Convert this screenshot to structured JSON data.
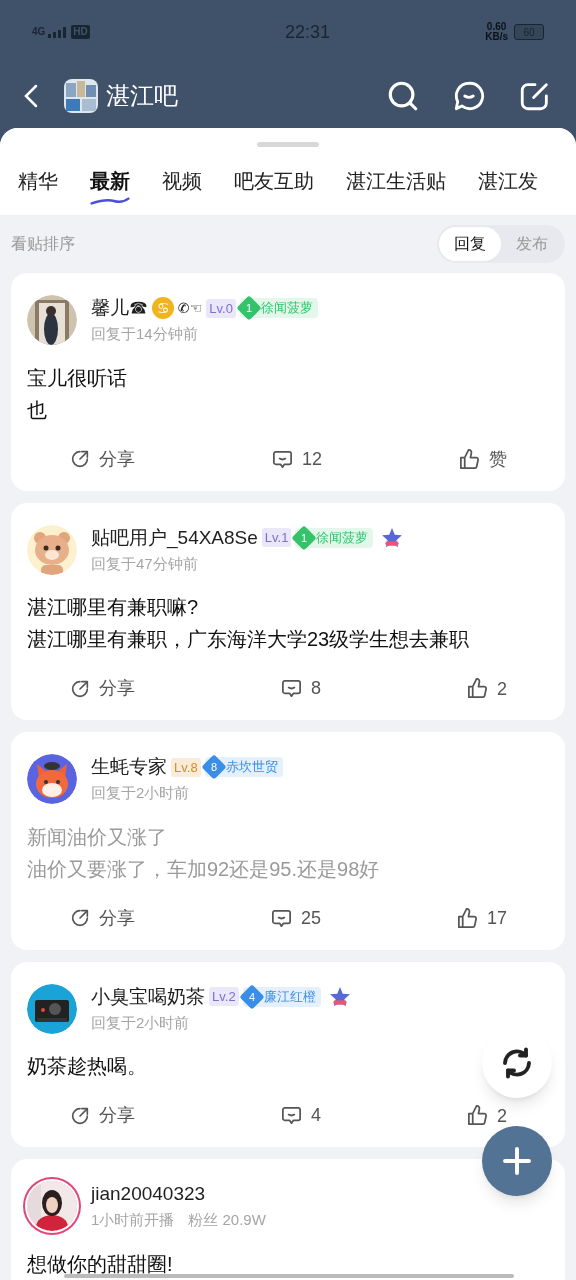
{
  "status_bar": {
    "network": "4G",
    "hd": "HD",
    "time": "22:31",
    "speed": "0.60",
    "speed_unit": "KB/s",
    "battery": "60"
  },
  "header": {
    "title": "湛江吧"
  },
  "tabs": [
    {
      "label": "精华",
      "selected": false
    },
    {
      "label": "最新",
      "selected": true
    },
    {
      "label": "视频",
      "selected": false
    },
    {
      "label": "吧友互助",
      "selected": false
    },
    {
      "label": "湛江生活贴",
      "selected": false
    },
    {
      "label": "湛江发",
      "selected": false
    }
  ],
  "sort": {
    "label": "看贴排序",
    "options": [
      {
        "label": "回复",
        "selected": true
      },
      {
        "label": "发布",
        "selected": false
      }
    ]
  },
  "posts": [
    {
      "kind": "reply",
      "name": "馨儿☎",
      "emoji": "♋",
      "symbols": "✆☜",
      "level": {
        "label": "Lv.0",
        "color": "#7c6fd6"
      },
      "fan": {
        "number": "1",
        "name": "徐闻菠萝",
        "color": "#34c26b"
      },
      "medal": false,
      "meta": "回复于14分钟前",
      "title": "宝儿很听话",
      "body": "也",
      "read": false,
      "share": "分享",
      "comments": "12",
      "likes": "赞"
    },
    {
      "kind": "reply",
      "name": "贴吧用户_54XA8Se",
      "level": {
        "label": "Lv.1",
        "color": "#7c6fd6"
      },
      "fan": {
        "number": "1",
        "name": "徐闻菠萝",
        "color": "#34c26b"
      },
      "medal": true,
      "meta": "回复于47分钟前",
      "title": "湛江哪里有兼职嘛?",
      "body": "湛江哪里有兼职，广东海洋大学23级学生想去兼职",
      "read": false,
      "share": "分享",
      "comments": "8",
      "likes": "2"
    },
    {
      "kind": "reply",
      "name": "生蚝专家",
      "level": {
        "label": "Lv.8",
        "color": "#e08a1e"
      },
      "fan": {
        "number": "8",
        "name": "赤坎世贸",
        "color": "#3a8ee6"
      },
      "medal": false,
      "meta": "回复于2小时前",
      "title": "新闻油价又涨了",
      "body": "油价又要涨了，车加92还是95.还是98好",
      "read": true,
      "share": "分享",
      "comments": "25",
      "likes": "17"
    },
    {
      "kind": "reply",
      "name": "小臭宝喝奶茶",
      "level": {
        "label": "Lv.2",
        "color": "#7c6fd6"
      },
      "fan": {
        "number": "4",
        "name": "廉江红橙",
        "color": "#3a8ee6"
      },
      "medal": true,
      "meta": "回复于2小时前",
      "title": "奶茶趁热喝。",
      "read": false,
      "share": "分享",
      "comments": "4",
      "likes": "2"
    },
    {
      "kind": "live",
      "name": "jian20040323",
      "meta": "1小时前开播",
      "fans": "粉丝 20.9W",
      "title": "想做你的甜甜圈!",
      "read": false
    }
  ]
}
